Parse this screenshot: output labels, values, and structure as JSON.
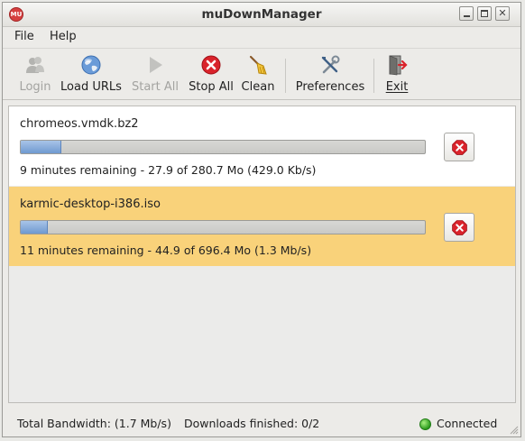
{
  "window": {
    "title": "muDownManager",
    "app_icon_text": "MU"
  },
  "menu": {
    "file": "File",
    "help": "Help"
  },
  "toolbar": {
    "login": "Login",
    "load_urls": "Load URLs",
    "start_all": "Start All",
    "stop_all": "Stop All",
    "clean": "Clean",
    "preferences": "Preferences",
    "exit": "Exit"
  },
  "downloads": [
    {
      "name": "chromeos.vmdk.bz2",
      "progress": 0.099,
      "status": "9 minutes remaining - 27.9 of 280.7 Mo (429.0 Kb/s)",
      "background": "#ffffff"
    },
    {
      "name": "karmic-desktop-i386.iso",
      "progress": 0.064,
      "status": "11 minutes remaining - 44.9 of 696.4 Mo (1.3 Mb/s)",
      "background": "#f9d27a"
    }
  ],
  "statusbar": {
    "bandwidth": "Total Bandwidth: (1.7 Mb/s)",
    "finished": "Downloads finished: 0/2",
    "connection": "Connected"
  },
  "colors": {
    "selected_row": "#f9d27a",
    "progress_fill": "#6f99d0",
    "stop_red": "#d9232b",
    "connected_green": "#2d9b1e"
  }
}
